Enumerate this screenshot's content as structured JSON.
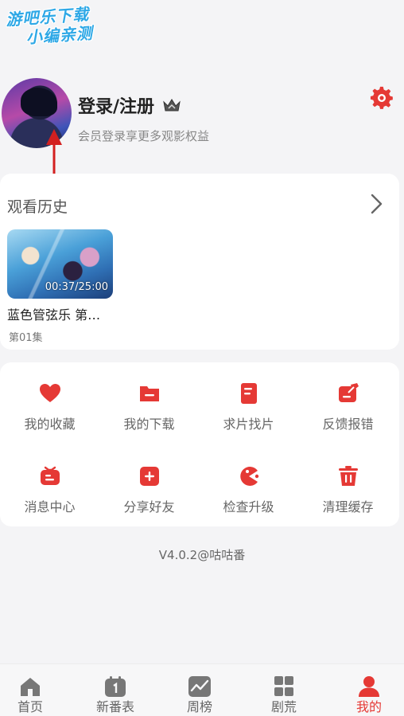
{
  "watermark": {
    "line1": "游吧乐下载",
    "line2": "小编亲测"
  },
  "profile": {
    "login_label": "登录/注册",
    "subtitle": "会员登录享更多观影权益"
  },
  "history": {
    "title": "观看历史",
    "items": [
      {
        "title": "蓝色管弦乐 第…",
        "episode": "第01集",
        "duration": "00:37/25:00"
      }
    ]
  },
  "menu": {
    "items": [
      {
        "label": "我的收藏",
        "icon": "heart-icon"
      },
      {
        "label": "我的下载",
        "icon": "download-folder-icon"
      },
      {
        "label": "求片找片",
        "icon": "request-doc-icon"
      },
      {
        "label": "反馈报错",
        "icon": "feedback-edit-icon"
      },
      {
        "label": "消息中心",
        "icon": "message-icon"
      },
      {
        "label": "分享好友",
        "icon": "share-plus-icon"
      },
      {
        "label": "检查升级",
        "icon": "upgrade-pacman-icon"
      },
      {
        "label": "清理缓存",
        "icon": "trash-icon"
      }
    ]
  },
  "version": "V4.0.2@咕咕番",
  "tabs": [
    {
      "label": "首页",
      "icon": "home-icon",
      "active": false
    },
    {
      "label": "新番表",
      "icon": "calendar-icon",
      "active": false
    },
    {
      "label": "周榜",
      "icon": "trend-chart-icon",
      "active": false
    },
    {
      "label": "剧荒",
      "icon": "grid-icon",
      "active": false
    },
    {
      "label": "我的",
      "icon": "user-icon",
      "active": true
    }
  ],
  "colors": {
    "accent": "#e53935",
    "background": "#f4f4f6",
    "card": "#ffffff",
    "tab_inactive": "#666666"
  }
}
